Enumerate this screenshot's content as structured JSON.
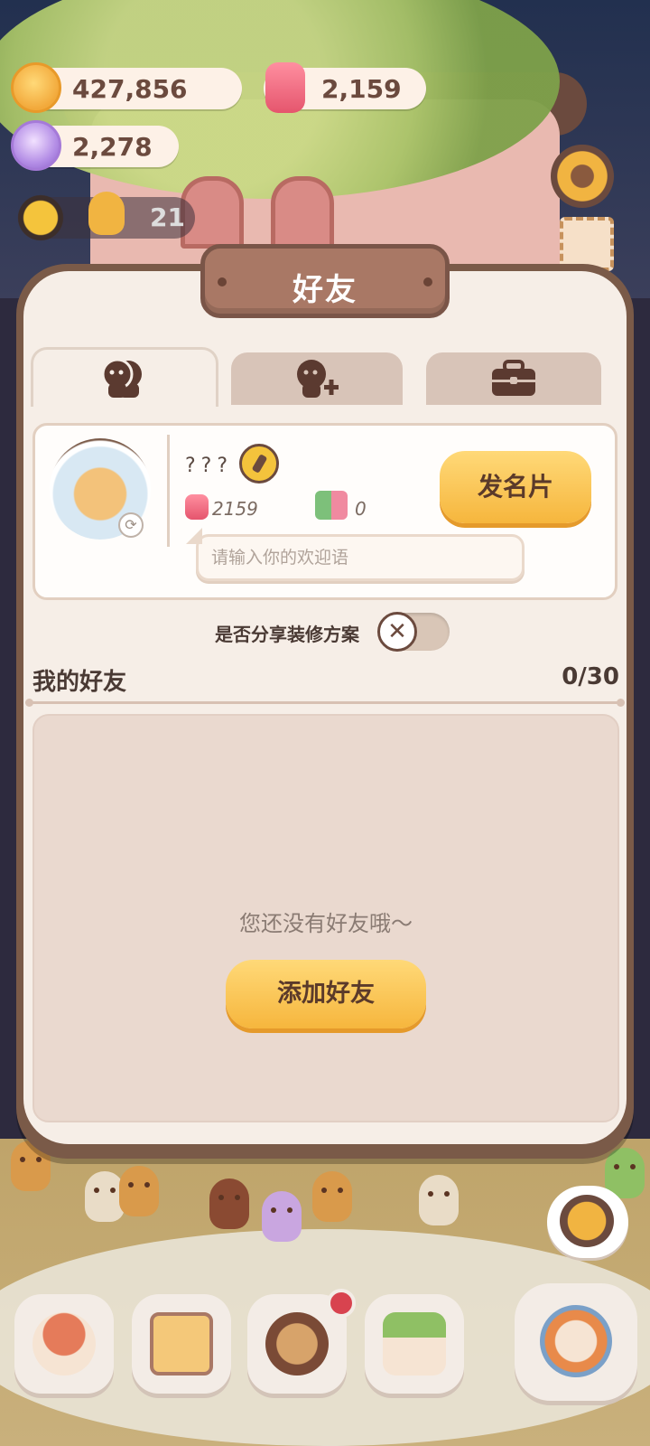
{
  "currency": {
    "coins": "427,856",
    "candles": "2,159",
    "crystals": "2,278"
  },
  "level": {
    "value": "21"
  },
  "dialog": {
    "title": "好友",
    "tabs": [
      {
        "icon": "friends-icon",
        "active": true
      },
      {
        "icon": "add-friend-icon",
        "active": false
      },
      {
        "icon": "briefcase-icon",
        "active": false
      }
    ],
    "profile": {
      "name": "???",
      "candles": "2159",
      "gifts": "0",
      "greeting_placeholder": "请输入你的欢迎语",
      "send_card_label": "发名片"
    },
    "share_label": "是否分享装修方案",
    "share_toggle_on": false,
    "friends_title": "我的好友",
    "friends_count": "0/30",
    "empty_text": "您还没有好友哦～",
    "add_friend_label": "添加好友"
  },
  "nav": [
    {
      "icon": "house-build-icon"
    },
    {
      "icon": "notebook-icon"
    },
    {
      "icon": "cookie-portrait-icon"
    },
    {
      "icon": "shop-icon"
    },
    {
      "icon": "alarm-fish-icon"
    }
  ],
  "colors": {
    "accent_yellow": "#f6b63d",
    "panel_brown": "#7a5a48",
    "panel_bg": "#f6eee7",
    "text_dark": "#4a3a34",
    "badge_red": "#d8434f"
  }
}
